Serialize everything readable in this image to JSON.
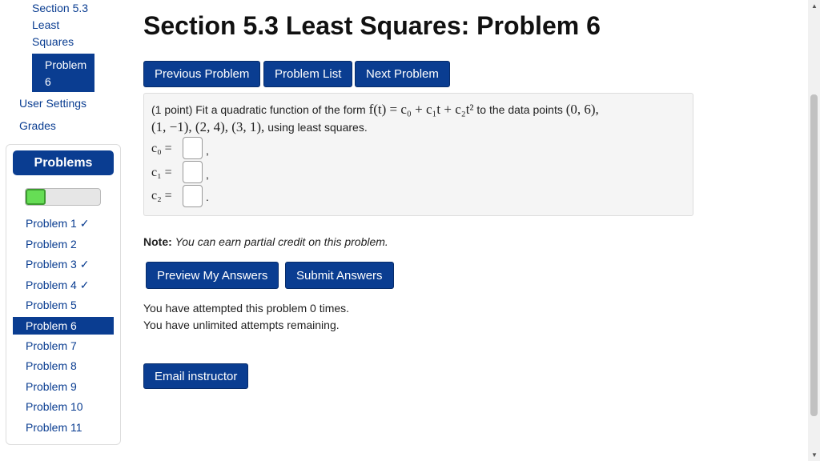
{
  "sidebar": {
    "course_link_line1": "Section 5.3",
    "course_link_line2": "Least",
    "course_link_line3": "Squares",
    "current_problem_line1": "Problem",
    "current_problem_line2": "6",
    "user_settings": "User Settings",
    "grades": "Grades",
    "problems_header": "Problems",
    "progress_fraction": 0.27,
    "problems": [
      {
        "label": "Problem 1 ✓"
      },
      {
        "label": "Problem 2"
      },
      {
        "label": "Problem 3 ✓"
      },
      {
        "label": "Problem 4 ✓"
      },
      {
        "label": "Problem 5"
      },
      {
        "label": "Problem 6"
      },
      {
        "label": "Problem 7"
      },
      {
        "label": "Problem 8"
      },
      {
        "label": "Problem 9"
      },
      {
        "label": "Problem 10"
      },
      {
        "label": "Problem 11"
      }
    ]
  },
  "main": {
    "title": "Section 5.3 Least Squares: Problem 6",
    "buttons": {
      "previous": "Previous Problem",
      "list": "Problem List",
      "next": "Next Problem"
    },
    "problem": {
      "intro": "(1 point) Fit a quadratic function of the form",
      "formula": "f(t) = c₀ + c₁t + c₂t²",
      "to_points": "to the data points",
      "point1": "(0, 6),",
      "points_rest": "(1, −1), (2, 4), (3, 1),",
      "method": "using least squares.",
      "answers": [
        {
          "label": "c₀ =",
          "value": "",
          "punct": ","
        },
        {
          "label": "c₁ =",
          "value": "",
          "punct": ","
        },
        {
          "label": "c₂ =",
          "value": "",
          "punct": "."
        }
      ]
    },
    "note_label": "Note:",
    "note_text": "You can earn partial credit on this problem.",
    "preview_button": "Preview My Answers",
    "submit_button": "Submit Answers",
    "attempts_text": "You have attempted this problem 0 times.",
    "remaining_text": "You have unlimited attempts remaining.",
    "email_button": "Email instructor"
  }
}
